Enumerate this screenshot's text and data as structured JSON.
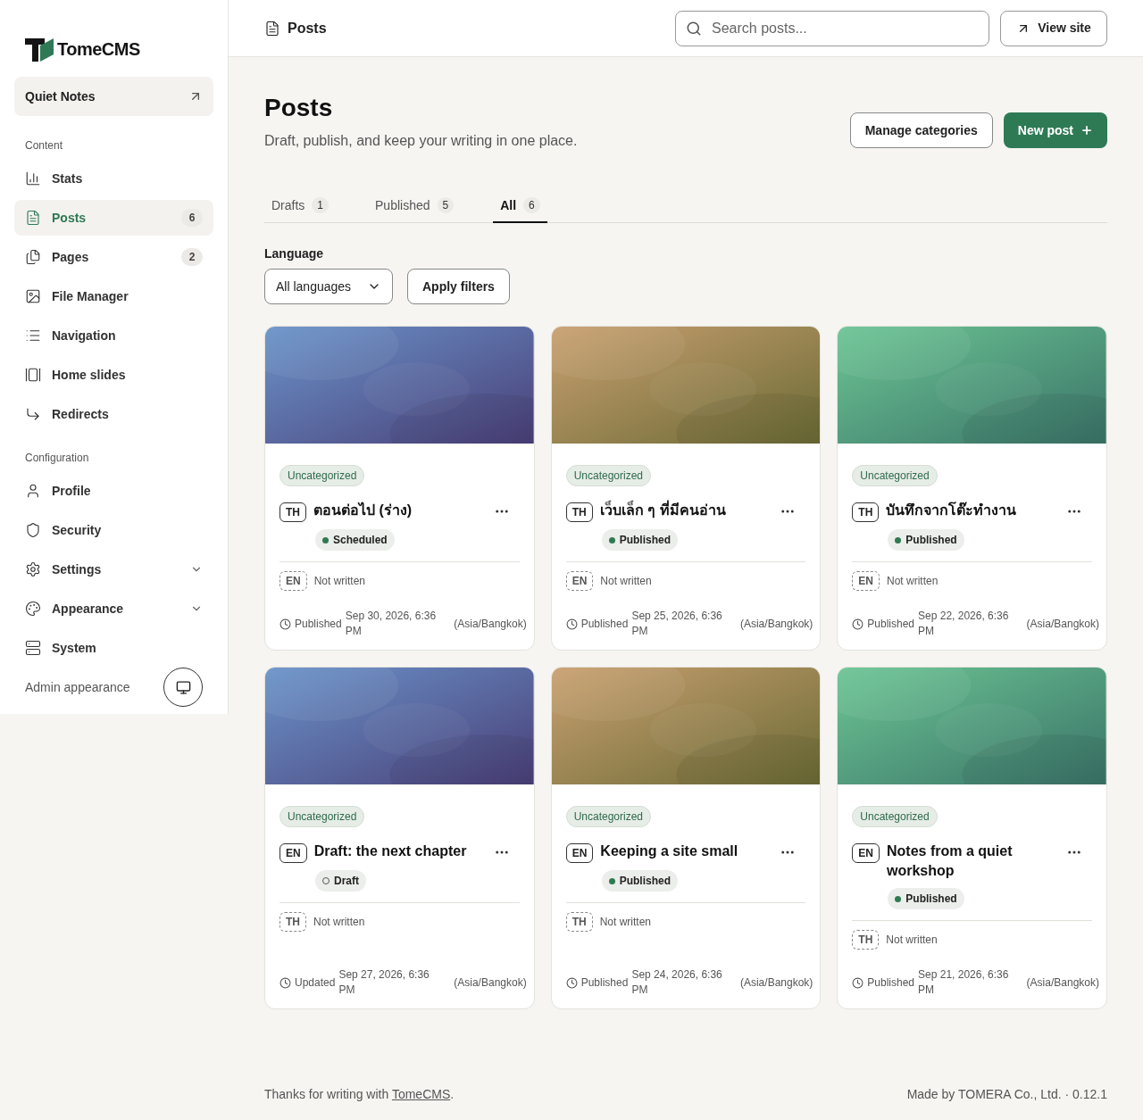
{
  "sidebar": {
    "logo": "TomeCMS",
    "site": "Quiet Notes",
    "sections": [
      {
        "title": "Content",
        "items": [
          {
            "label": "Stats",
            "selected": false
          },
          {
            "label": "Posts",
            "selected": true,
            "count": "6"
          },
          {
            "label": "Pages",
            "selected": false,
            "count": "2"
          },
          {
            "label": "File Manager",
            "selected": false
          },
          {
            "label": "Navigation",
            "selected": false
          },
          {
            "label": "Home slides",
            "selected": false
          },
          {
            "label": "Redirects",
            "selected": false
          }
        ]
      },
      {
        "title": "Configuration",
        "items": [
          {
            "label": "Profile",
            "selected": false
          },
          {
            "label": "Security",
            "selected": false
          },
          {
            "label": "Settings",
            "selected": false,
            "expanded": false
          },
          {
            "label": "Appearance",
            "selected": false,
            "expanded": false
          },
          {
            "label": "System",
            "selected": false
          }
        ]
      }
    ],
    "admin_appearance": "Admin appearance"
  },
  "topbar": {
    "title": "Posts",
    "search": {
      "placeholder": "Search posts..."
    },
    "view_site": "View site"
  },
  "page": {
    "title": "Posts",
    "subtitle": "Draft, publish, and keep your writing in one place.",
    "actions": [
      "Manage categories",
      "New post"
    ]
  },
  "tabs": [
    {
      "label": "Drafts",
      "count": "1",
      "selected": false
    },
    {
      "label": "Published",
      "count": "5",
      "selected": false
    },
    {
      "label": "All",
      "count": "6",
      "selected": true
    }
  ],
  "filters": {
    "label": "Language",
    "value": "All languages",
    "apply": "Apply filters"
  },
  "posts": [
    {
      "category": "Uncategorized",
      "lang": "TH",
      "title": "ตอนต่อไป (ร่าง)",
      "status": {
        "label": "Scheduled",
        "kind": "filled"
      },
      "other_lang": "EN",
      "other_status": "Not written",
      "date_label": "Published",
      "date": "Sep 30, 2026, 6:36 PM",
      "zone": "(Asia/Bangkok)"
    },
    {
      "category": "Uncategorized",
      "lang": "TH",
      "title": "เว็บเล็ก ๆ ที่มีคนอ่าน",
      "status": {
        "label": "Published",
        "kind": "filled"
      },
      "other_lang": "EN",
      "other_status": "Not written",
      "date_label": "Published",
      "date": "Sep 25, 2026, 6:36 PM",
      "zone": "(Asia/Bangkok)"
    },
    {
      "category": "Uncategorized",
      "lang": "TH",
      "title": "บันทึกจากโต๊ะทำงาน",
      "status": {
        "label": "Published",
        "kind": "filled"
      },
      "other_lang": "EN",
      "other_status": "Not written",
      "date_label": "Published",
      "date": "Sep 22, 2026, 6:36 PM",
      "zone": "(Asia/Bangkok)"
    },
    {
      "category": "Uncategorized",
      "lang": "EN",
      "title": "Draft: the next chapter",
      "status": {
        "label": "Draft",
        "kind": "hollow"
      },
      "other_lang": "TH",
      "other_status": "Not written",
      "date_label": "Updated",
      "date": "Sep 27, 2026, 6:36 PM",
      "zone": "(Asia/Bangkok)"
    },
    {
      "category": "Uncategorized",
      "lang": "EN",
      "title": "Keeping a site small",
      "status": {
        "label": "Published",
        "kind": "filled"
      },
      "other_lang": "TH",
      "other_status": "Not written",
      "date_label": "Published",
      "date": "Sep 24, 2026, 6:36 PM",
      "zone": "(Asia/Bangkok)"
    },
    {
      "category": "Uncategorized",
      "lang": "EN",
      "title": "Notes from a quiet workshop",
      "status": {
        "label": "Published",
        "kind": "filled"
      },
      "other_lang": "TH",
      "other_status": "Not written",
      "date_label": "Published",
      "date": "Sep 21, 2026, 6:36 PM",
      "zone": "(Asia/Bangkok)"
    }
  ],
  "footer": {
    "before": "Thanks for writing with ",
    "link": "TomeCMS",
    "after": ".",
    "right": "Made by TOMERA Co., Ltd. · 0.12.1"
  }
}
